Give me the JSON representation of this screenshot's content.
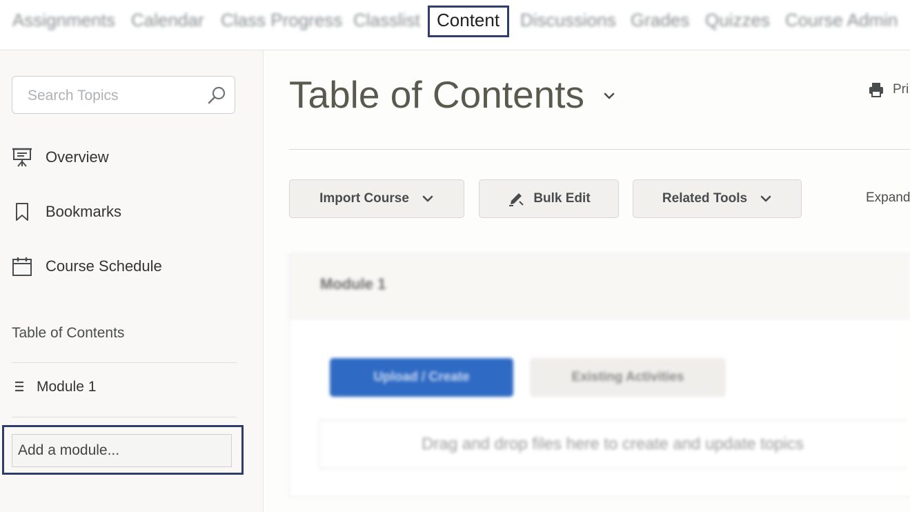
{
  "topnav": {
    "items": [
      {
        "label": "Assignments"
      },
      {
        "label": "Calendar"
      },
      {
        "label": "Class Progress"
      },
      {
        "label": "Classlist"
      },
      {
        "label": "Content"
      },
      {
        "label": "Discussions"
      },
      {
        "label": "Grades"
      },
      {
        "label": "Quizzes"
      },
      {
        "label": "Course Admin"
      }
    ],
    "active": "Content"
  },
  "sidebar": {
    "search_placeholder": "Search Topics",
    "links": [
      {
        "label": "Overview",
        "icon": "presentation-icon"
      },
      {
        "label": "Bookmarks",
        "icon": "bookmark-icon"
      },
      {
        "label": "Course Schedule",
        "icon": "calendar-icon"
      }
    ],
    "toc_heading": "Table of Contents",
    "modules": [
      {
        "label": "Module 1"
      }
    ],
    "add_module_placeholder": "Add a module..."
  },
  "main": {
    "title": "Table of Contents",
    "print_label": "Pri",
    "buttons": {
      "import_course": "Import Course",
      "bulk_edit": "Bulk Edit",
      "related_tools": "Related Tools"
    },
    "expand_label": "Expand",
    "module_panel": {
      "title": "Module 1",
      "upload_create": "Upload / Create",
      "existing_activities": "Existing Activities",
      "dropzone_text": "Drag and drop files here to create and update topics"
    }
  },
  "colors": {
    "highlight_border": "#2f3d6b",
    "primary_button": "#2f6bc4",
    "title_text": "#59594d"
  }
}
